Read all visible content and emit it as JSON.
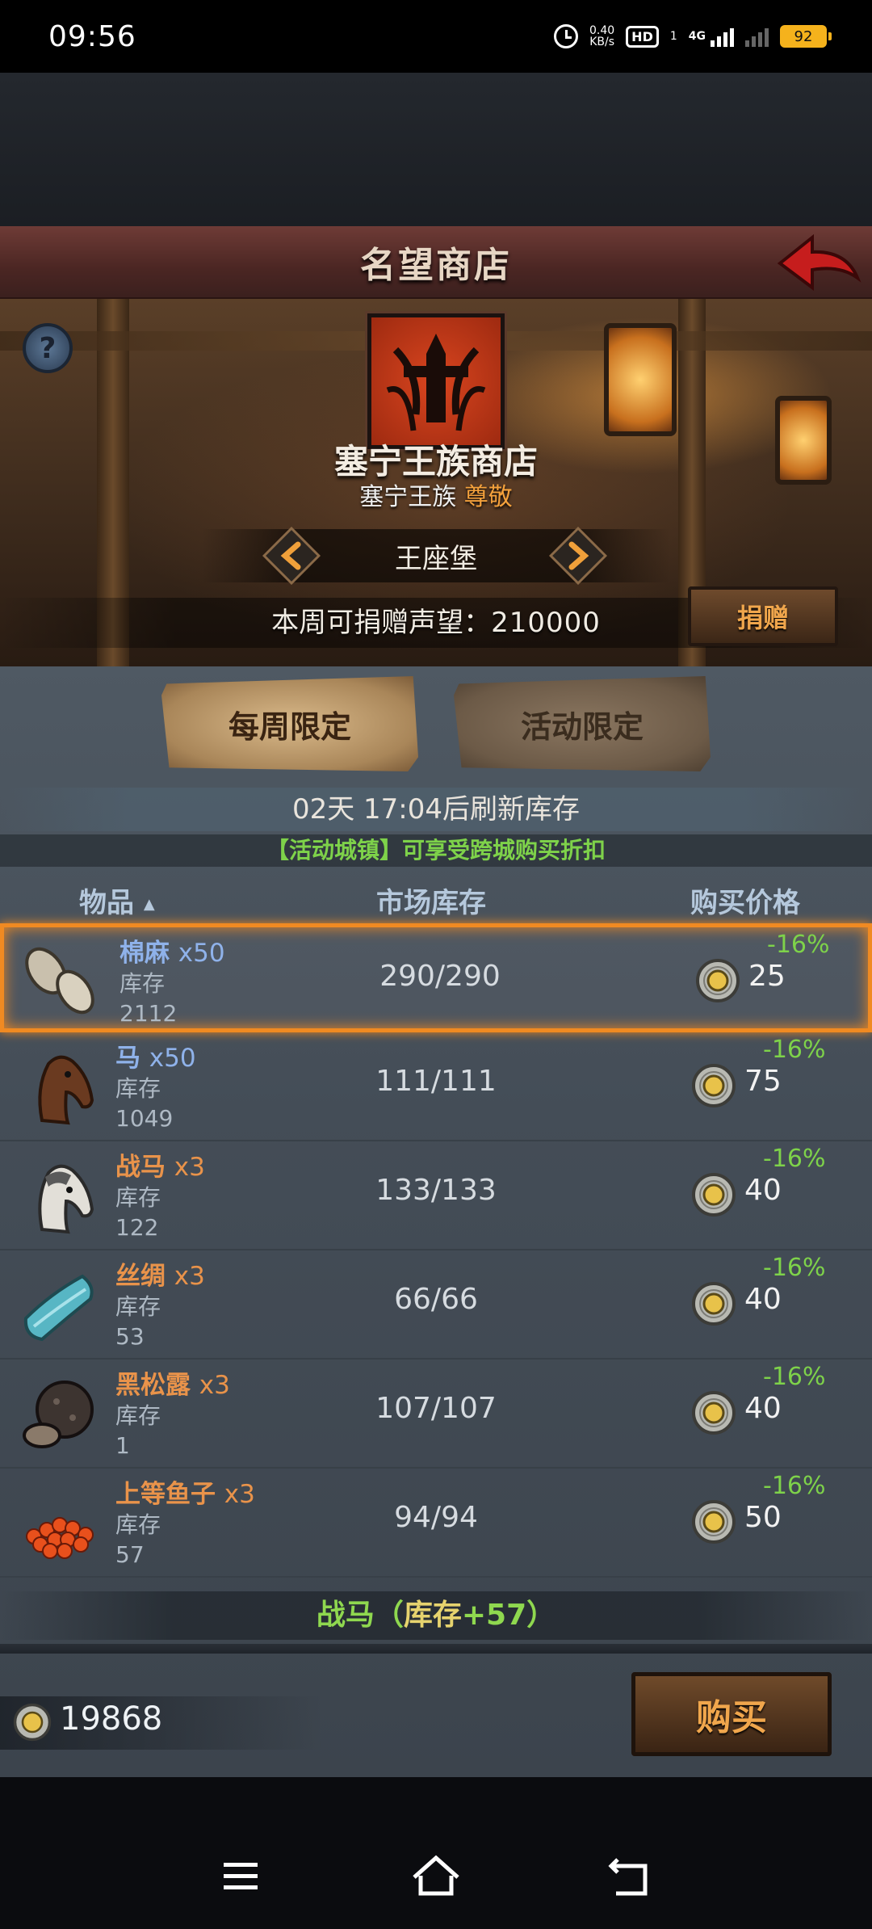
{
  "status_bar": {
    "time": "09:56",
    "net_speed_top": "0.40",
    "net_speed_unit": "KB/s",
    "hd_label": "HD",
    "sim_index": "1",
    "network": "4G",
    "battery": "92"
  },
  "header": {
    "title": "名望商店"
  },
  "shop": {
    "name": "塞宁王族商店",
    "faction": "塞宁王族",
    "rank": "尊敬",
    "city": "王座堡",
    "donate_text": "本周可捐赠声望：",
    "donate_value": "210000",
    "donate_button": "捐赠"
  },
  "tabs": [
    {
      "label": "每周限定",
      "active": true
    },
    {
      "label": "活动限定",
      "active": false
    }
  ],
  "refresh_text": "02天 17:04后刷新库存",
  "discount_note": "【活动城镇】可享受跨城购买折扣",
  "columns": {
    "item": "物品",
    "market": "市场库存",
    "price": "购买价格"
  },
  "items": [
    {
      "name": "棉麻",
      "qty": "x50",
      "stock_label": "库存",
      "stock": "2112",
      "market": "290/290",
      "price": "25",
      "discount": "-16%",
      "name_color": "#8fb2ea",
      "icon": "linen-roll-icon"
    },
    {
      "name": "马",
      "qty": "x50",
      "stock_label": "库存",
      "stock": "1049",
      "market": "111/111",
      "price": "75",
      "discount": "-16%",
      "name_color": "#8fb2ea",
      "icon": "horse-icon"
    },
    {
      "name": "战马",
      "qty": "x3",
      "stock_label": "库存",
      "stock": "122",
      "market": "133/133",
      "price": "40",
      "discount": "-16%",
      "name_color": "#e9934a",
      "icon": "warhorse-icon"
    },
    {
      "name": "丝绸",
      "qty": "x3",
      "stock_label": "库存",
      "stock": "53",
      "market": "66/66",
      "price": "40",
      "discount": "-16%",
      "name_color": "#e9934a",
      "icon": "silk-icon"
    },
    {
      "name": "黑松露",
      "qty": "x3",
      "stock_label": "库存",
      "stock": "1",
      "market": "107/107",
      "price": "40",
      "discount": "-16%",
      "name_color": "#e9934a",
      "icon": "truffle-icon"
    },
    {
      "name": "上等鱼子",
      "qty": "x3",
      "stock_label": "库存",
      "stock": "57",
      "market": "94/94",
      "price": "50",
      "discount": "-16%",
      "name_color": "#e9934a",
      "icon": "caviar-icon"
    }
  ],
  "selected_item_summary": {
    "name": "战马",
    "paren_open": "（",
    "stock_label": "库存",
    "delta": "+57",
    "paren_close": "）"
  },
  "balance": "19868",
  "buy_button": "购买",
  "colors": {
    "accent_orange": "#f08a22",
    "discount_green": "#7ed24a",
    "rank_orange": "#f4a13c"
  }
}
